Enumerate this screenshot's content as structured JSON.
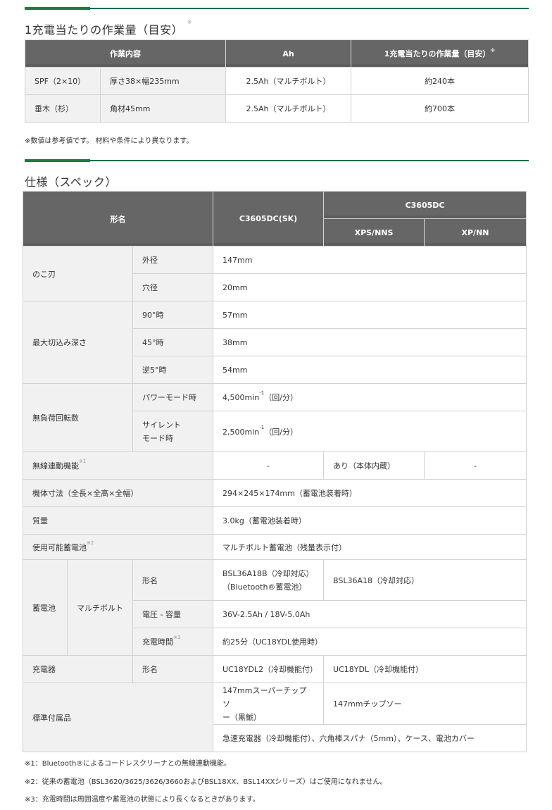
{
  "work_section": {
    "title": "1充電当たりの作業量（目安）",
    "title_mark": "※",
    "headers": [
      "作業内容",
      "Ah",
      "1充電当たりの作業量（目安）"
    ],
    "header_mark": "※",
    "rows": [
      {
        "material": "SPF（2×10）",
        "size": "厚さ38×幅235mm",
        "ah": "2.5Ah（マルチボルト）",
        "amount": "約240本"
      },
      {
        "material": "垂木（杉）",
        "size": "角材45mm",
        "ah": "2.5Ah（マルチボルト）",
        "amount": "約700本"
      }
    ],
    "note": "※数値は参考値です。 材料や条件により異なります。"
  },
  "spec_section": {
    "title": "仕様（スペック）",
    "header": {
      "model_label": "形名",
      "model_sk": "C3605DC(SK)",
      "model_group": "C3605DC",
      "variant_1": "XPS/NNS",
      "variant_2": "XP/NN"
    },
    "blade": {
      "label": "のこ刃",
      "outer_label": "外径",
      "outer_value": "147mm",
      "hole_label": "穴径",
      "hole_value": "20mm"
    },
    "cut_depth": {
      "label": "最大切込み深さ",
      "rows": [
        {
          "label": "90°時",
          "value": "57mm"
        },
        {
          "label": "45°時",
          "value": "38mm"
        },
        {
          "label": "逆5°時",
          "value": "54mm"
        }
      ]
    },
    "rpm": {
      "label": "無負荷回転数",
      "power_label": "パワーモード時",
      "power_value": "4,500min",
      "power_unit": "（回/分）",
      "silent_label_1": "サイレント",
      "silent_label_2": "モード時",
      "silent_value": "2,500min",
      "silent_unit": "（回/分）",
      "exponent": "-1"
    },
    "wireless": {
      "label": "無線連動機能",
      "mark": "※1",
      "sk": "-",
      "xps": "あり（本体内蔵）",
      "xp": "-"
    },
    "dimensions": {
      "label": "機体寸法（全長×全高×全幅）",
      "value": "294×245×174mm（蓄電池装着時）"
    },
    "mass": {
      "label": "質量",
      "value": "3.0kg（蓄電池装着時）"
    },
    "usable_battery": {
      "label": "使用可能蓄電池",
      "mark": "※2",
      "value": "マルチボルト蓄電池（残量表示付）"
    },
    "battery": {
      "label": "蓄電池",
      "sub_label": "マルチボルト",
      "model_label": "形名",
      "model_sk_1": "BSL36A18B（冷却対応）",
      "model_sk_2": "（Bluetooth®蓄電池）",
      "model_other": "BSL36A18（冷却対応）",
      "voltage_label": "電圧 - 容量",
      "voltage_value": "36V-2.5Ah / 18V-5.0Ah",
      "charge_label": "充電時間",
      "charge_mark": "※3",
      "charge_value": "約25分（UC18YDL使用時）"
    },
    "charger": {
      "label": "充電器",
      "model_label": "形名",
      "sk": "UC18YDL2（冷却機能付）",
      "other": "UC18YDL（冷却機能付）"
    },
    "accessories": {
      "label": "標準付属品",
      "sk_1": "147mmスーパーチップソ",
      "sk_2": "ー（黒鯱）",
      "other": "147mmチップソー",
      "common": "急速充電器（冷却機能付）、六角棒スパナ（5mm）、ケース、電池カバー"
    },
    "footnotes": [
      "※1：Bluetooth®によるコードレスクリーナとの無線連動機能。",
      "※2：従来の蓄電池（BSL3620/3625/3626/3660およびBSL18XX、BSL14XXシリーズ）はご使用になれません。",
      "※3：充電時間は周囲温度や蓄電池の状態により長くなるときがあります。"
    ]
  }
}
